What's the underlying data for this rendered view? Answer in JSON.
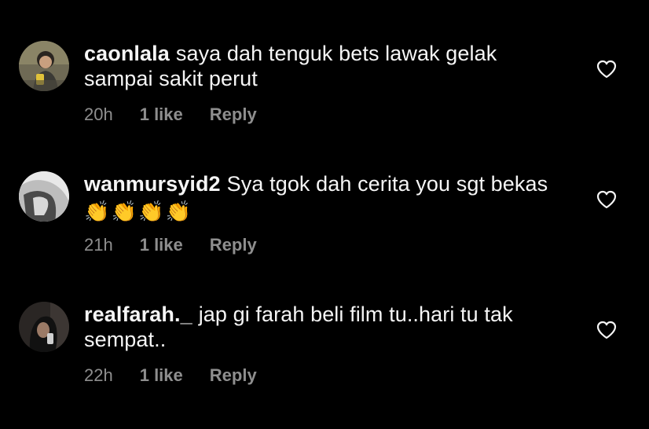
{
  "comments": [
    {
      "username": "caonlala",
      "text": "saya dah tenguk bets lawak gelak sampai sakit perut",
      "time": "20h",
      "likes": "1 like",
      "reply": "Reply",
      "emojis": []
    },
    {
      "username": "wanmursyid2",
      "text": "Sya tgok dah cerita you sgt bekas",
      "time": "21h",
      "likes": "1 like",
      "reply": "Reply",
      "emojis": [
        "👏",
        "👏",
        "👏",
        "👏"
      ]
    },
    {
      "username": "realfarah._",
      "text": "jap gi farah beli film tu..hari tu tak sempat..",
      "time": "22h",
      "likes": "1 like",
      "reply": "Reply",
      "emojis": []
    }
  ],
  "icons": {
    "like": "heart-outline-icon"
  },
  "colors": {
    "background": "#000000",
    "text": "#f5f5f5",
    "meta": "#8e8e8e"
  }
}
